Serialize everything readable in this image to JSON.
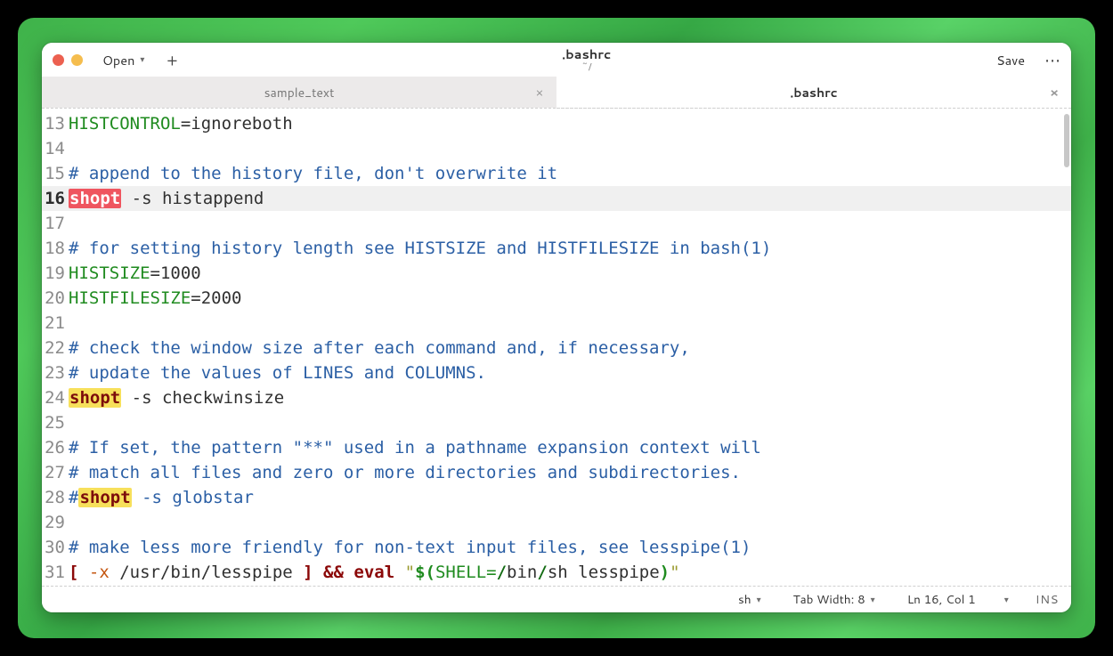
{
  "header": {
    "open_label": "Open",
    "title": ".bashrc",
    "subtitle": "~/",
    "save_label": "Save"
  },
  "tabs": [
    {
      "label": "sample_text",
      "active": false
    },
    {
      "label": ".bashrc",
      "active": true
    }
  ],
  "statusbar": {
    "lang": "sh",
    "tabwidth": "Tab Width: 8",
    "position": "Ln 16, Col 1",
    "mode": "INS"
  },
  "colors": {
    "variable": "#1f8b1f",
    "comment": "#2b5fa5",
    "highlight_bg": "#f7e05b",
    "selection_bg": "#ef555f",
    "operator": "#8b0808",
    "flag": "#c45610",
    "string": "#9a9a2f"
  },
  "code": [
    {
      "n": 13,
      "src": [
        {
          "t": "HISTCONTROL",
          "c": "c-var"
        },
        {
          "t": "=ignoreboth"
        }
      ]
    },
    {
      "n": 14,
      "src": []
    },
    {
      "n": 15,
      "src": [
        {
          "t": "# append to the history file, don't overwrite it",
          "c": "c-cmt"
        }
      ]
    },
    {
      "n": 16,
      "current": true,
      "src": [
        {
          "t": "shopt",
          "c": "c-sel"
        },
        {
          "t": " -s histappend"
        }
      ]
    },
    {
      "n": 17,
      "src": []
    },
    {
      "n": 18,
      "src": [
        {
          "t": "# for setting history length see HISTSIZE and HISTFILESIZE in bash(1)",
          "c": "c-cmt"
        }
      ]
    },
    {
      "n": 19,
      "src": [
        {
          "t": "HISTSIZE",
          "c": "c-var"
        },
        {
          "t": "=1000"
        }
      ]
    },
    {
      "n": 20,
      "src": [
        {
          "t": "HISTFILESIZE",
          "c": "c-var"
        },
        {
          "t": "=2000"
        }
      ]
    },
    {
      "n": 21,
      "src": []
    },
    {
      "n": 22,
      "src": [
        {
          "t": "# check the window size after each command and, if necessary,",
          "c": "c-cmt"
        }
      ]
    },
    {
      "n": 23,
      "src": [
        {
          "t": "# update the values of LINES and COLUMNS.",
          "c": "c-cmt"
        }
      ]
    },
    {
      "n": 24,
      "src": [
        {
          "t": "shopt",
          "c": "c-hl"
        },
        {
          "t": " -s checkwinsize"
        }
      ]
    },
    {
      "n": 25,
      "src": []
    },
    {
      "n": 26,
      "src": [
        {
          "t": "# If set, the pattern \"**\" used in a pathname expansion context will",
          "c": "c-cmt"
        }
      ]
    },
    {
      "n": 27,
      "src": [
        {
          "t": "# match all files and zero or more directories and subdirectories.",
          "c": "c-cmt"
        }
      ]
    },
    {
      "n": 28,
      "src": [
        {
          "t": "#",
          "c": "c-cmt"
        },
        {
          "t": "shopt",
          "c": "c-hl"
        },
        {
          "t": " -s globstar",
          "c": "c-cmt"
        }
      ]
    },
    {
      "n": 29,
      "src": []
    },
    {
      "n": 30,
      "src": [
        {
          "t": "# make less more friendly for non-text input files, see lesspipe(1)",
          "c": "c-cmt"
        }
      ]
    },
    {
      "n": 31,
      "src": [
        {
          "t": "[",
          "c": "c-oper"
        },
        {
          "t": " "
        },
        {
          "t": "-x",
          "c": "c-flag"
        },
        {
          "t": " /usr/bin/lesspipe "
        },
        {
          "t": "]",
          "c": "c-oper"
        },
        {
          "t": " "
        },
        {
          "t": "&&",
          "c": "c-oper"
        },
        {
          "t": " "
        },
        {
          "t": "eval",
          "c": "c-oper"
        },
        {
          "t": " "
        },
        {
          "t": "\"",
          "c": "c-str"
        },
        {
          "t": "$(",
          "c": "c-sub"
        },
        {
          "t": "SHELL=",
          "c": "c-var"
        },
        {
          "t": "/",
          "c": "c-path"
        },
        {
          "t": "bin"
        },
        {
          "t": "/",
          "c": "c-path"
        },
        {
          "t": "sh lesspipe"
        },
        {
          "t": ")",
          "c": "c-sub"
        },
        {
          "t": "\"",
          "c": "c-str"
        }
      ]
    }
  ]
}
